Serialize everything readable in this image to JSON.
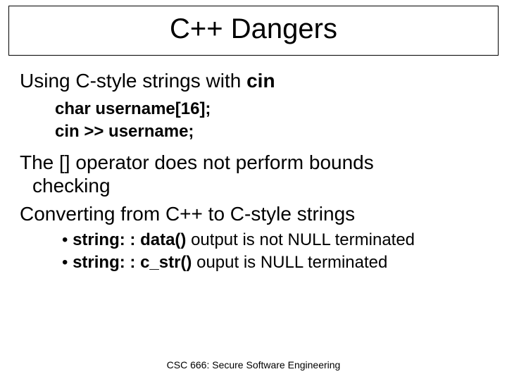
{
  "title": "C++ Dangers",
  "line1_a": "Using C-style strings with ",
  "line1_b": "cin",
  "code1": "char username[16];",
  "code2": "cin >> username;",
  "para1_a": "The [] operator does not perform bounds",
  "para1_b": "checking",
  "para2": "Converting from C++ to C-style strings",
  "bullet1_a": "string: : data()",
  "bullet1_b": " output is not NULL terminated",
  "bullet2_a": "string: : c_str()",
  "bullet2_b": " ouput is NULL terminated",
  "footer": "CSC 666: Secure Software Engineering"
}
